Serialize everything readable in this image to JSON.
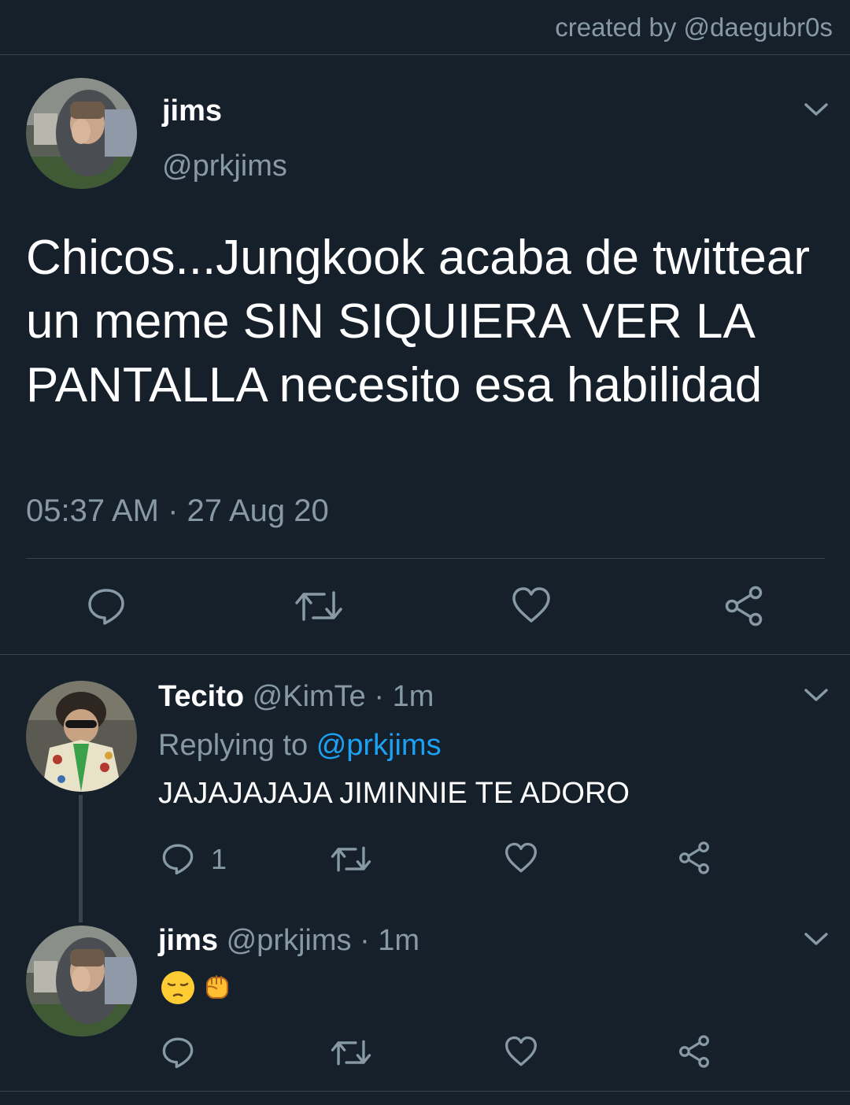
{
  "credit": "created by @daegubr0s",
  "tweet": {
    "name": "jims",
    "handle": "@prkjims",
    "text": "Chicos...Jungkook acaba de twittear un meme SIN SIQUIERA VER LA PANTALLA necesito esa habilidad",
    "timestamp": "05:37 AM · 27 Aug 20",
    "actions": [
      "reply-icon",
      "retweet-icon",
      "like-icon",
      "share-icon"
    ]
  },
  "replies": [
    {
      "name": "Tecito",
      "handle": "@KimTe",
      "time": "· 1m",
      "replying_prefix": "Replying to",
      "replying_to": "@prkjims",
      "text": "JAJAJAJAJA JIMINNIE TE ADORO",
      "reply_count": "1"
    },
    {
      "name": "jims",
      "handle": "@prkjims",
      "time": "· 1m",
      "emojis": [
        "pensive-face-emoji",
        "raised-fist-emoji"
      ]
    }
  ],
  "colors": {
    "background": "#15202b",
    "secondary_text": "#8899a6",
    "link": "#1da1f2",
    "divider": "#38444d"
  }
}
